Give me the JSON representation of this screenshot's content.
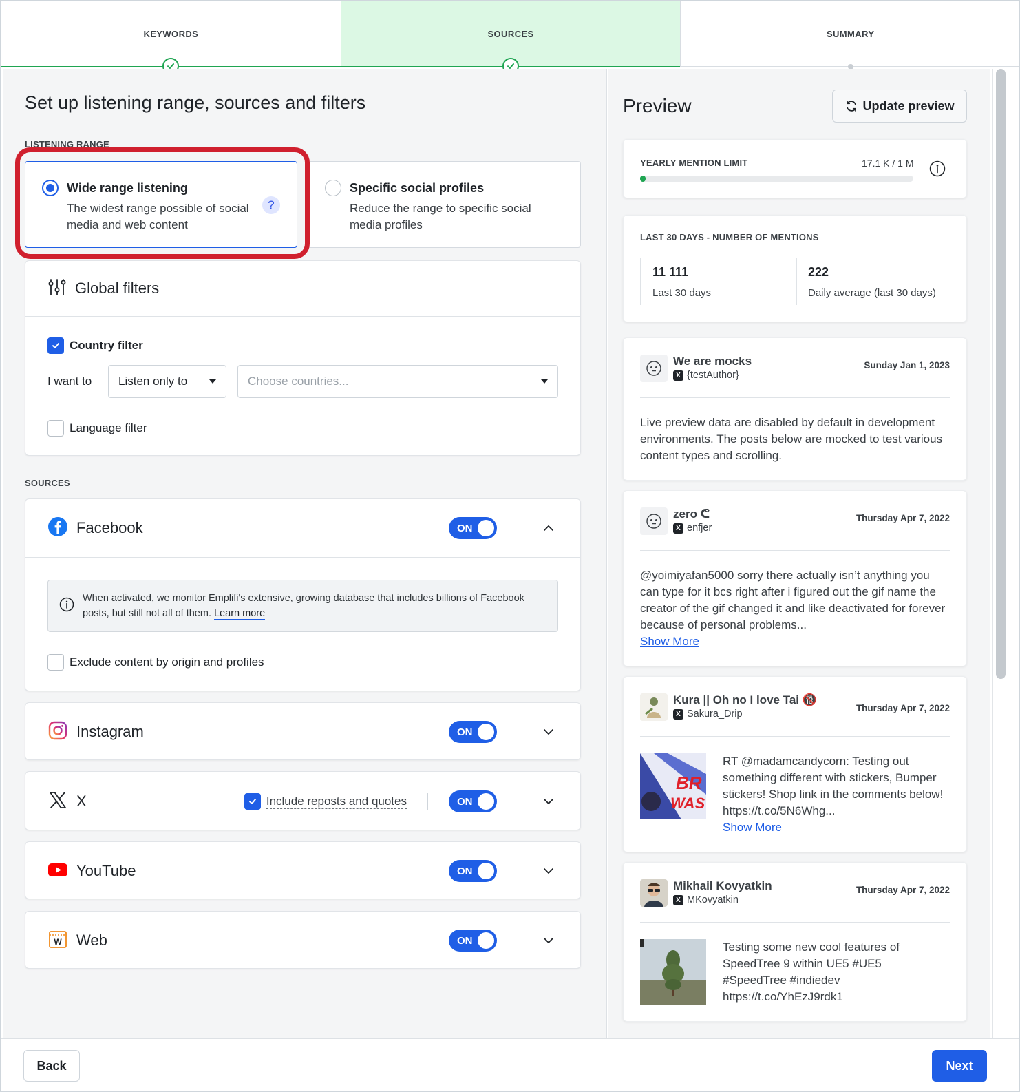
{
  "stepper": {
    "steps": [
      {
        "label": "KEYWORDS",
        "state": "done"
      },
      {
        "label": "SOURCES",
        "state": "active"
      },
      {
        "label": "SUMMARY",
        "state": "pending"
      }
    ]
  },
  "left": {
    "page_title": "Set up listening range, sources and filters",
    "listening_range_label": "LISTENING RANGE",
    "range_options": [
      {
        "title": "Wide range listening",
        "description": "The widest range possible of social media and web content",
        "selected": true,
        "help": "?"
      },
      {
        "title": "Specific social profiles",
        "description": "Reduce the range to specific social media profiles",
        "selected": false
      }
    ],
    "global_filters": {
      "title": "Global filters",
      "country_filter_label": "Country filter",
      "country_filter_checked": true,
      "i_want_to_label": "I want to",
      "mode_value": "Listen only to",
      "countries_placeholder": "Choose countries...",
      "language_filter_label": "Language filter",
      "language_filter_checked": false
    },
    "sources_label": "SOURCES",
    "sources": {
      "facebook": {
        "name": "Facebook",
        "toggle": "ON",
        "info_text": "When activated, we monitor Emplifi's extensive, growing database that includes billions of Facebook posts, but still not all of them.",
        "learn_more": "Learn more",
        "exclude_label": "Exclude content by origin and profiles"
      },
      "instagram": {
        "name": "Instagram",
        "toggle": "ON"
      },
      "x": {
        "name": "X",
        "toggle": "ON",
        "reposts_label": "Include reposts and quotes"
      },
      "youtube": {
        "name": "YouTube",
        "toggle": "ON"
      },
      "web": {
        "name": "Web",
        "toggle": "ON"
      }
    }
  },
  "preview": {
    "title": "Preview",
    "update_button": "Update preview",
    "yearly_limit": {
      "label": "YEARLY MENTION LIMIT",
      "value": "17.1 K / 1 M",
      "fraction": 0.0171
    },
    "mentions": {
      "label": "LAST 30 DAYS - NUMBER OF MENTIONS",
      "total_value": "11 111",
      "total_caption": "Last 30 days",
      "avg_value": "222",
      "avg_caption": "Daily average (last 30 days)"
    },
    "posts": [
      {
        "name": "We are mocks",
        "handle": "{testAuthor}",
        "date": "Sunday Jan 1, 2023",
        "text": "Live preview data are disabled by default in development environments. The posts below are mocked to test various content types and scrolling."
      },
      {
        "name": "zero ᕦ",
        "handle": "enfjer",
        "date": "Thursday Apr 7, 2022",
        "text": "@yoimiyafan5000 sorry there actually isn’t anything you can type for it bcs right after i figured out the gif name the creator of the gif changed it and like deactivated for forever because of personal problems...",
        "show_more": "Show More"
      },
      {
        "name": "Kura || Oh no I love Tai 🔞",
        "handle": "Sakura_Drip",
        "date": "Thursday Apr 7, 2022",
        "text": "RT @madamcandycorn: Testing out something different with stickers, Bumper stickers! Shop link in the comments below! https://t.co/5N6Whg...",
        "show_more": "Show More"
      },
      {
        "name": "Mikhail Kovyatkin",
        "handle": "MKovyatkin",
        "date": "Thursday Apr 7, 2022",
        "text": "Testing some new cool features of SpeedTree 9 within UE5 #UE5 #SpeedTree #indiedev https://t.co/YhEzJ9rdk1"
      }
    ]
  },
  "footer": {
    "back": "Back",
    "next": "Next"
  },
  "colors": {
    "accent": "#1f5ee6",
    "success": "#1fa552",
    "highlight": "#d0202e"
  }
}
